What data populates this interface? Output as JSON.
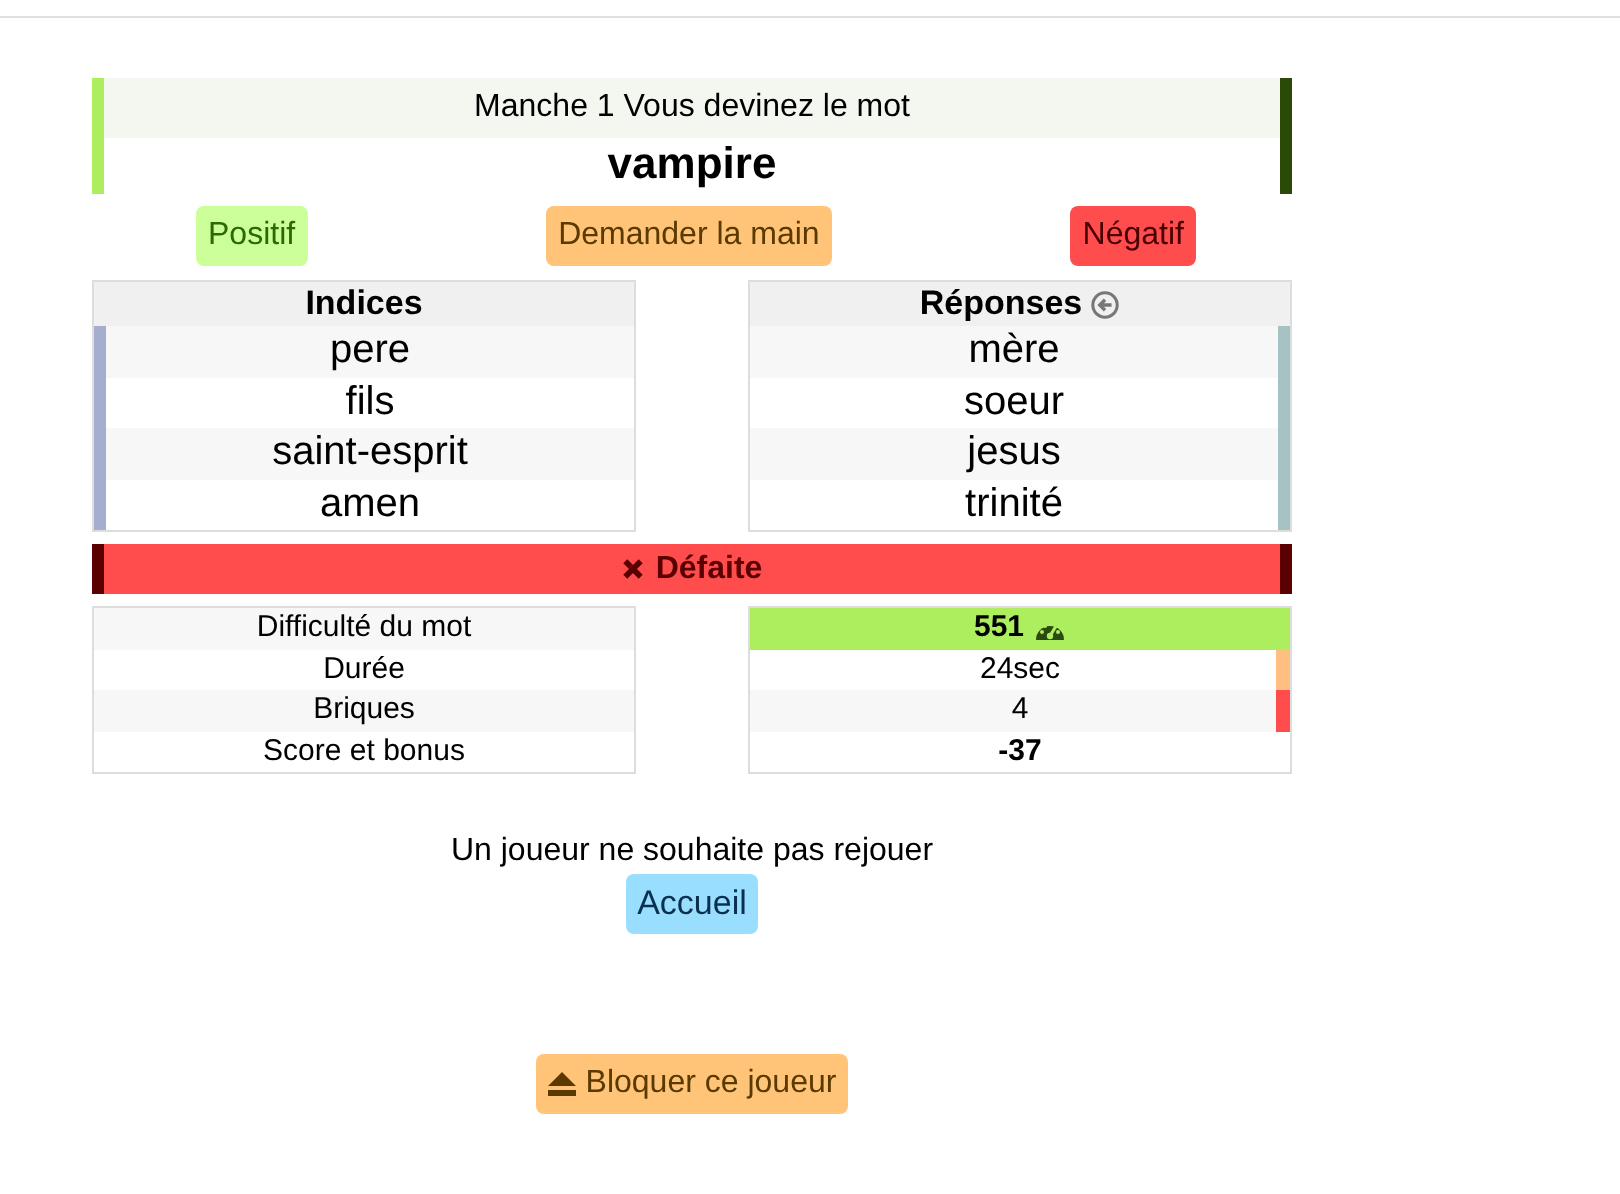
{
  "round": {
    "label": "Manche 1 Vous devinez le mot",
    "word": "vampire"
  },
  "actions": [
    {
      "label": "Positif",
      "kind": "positive"
    },
    {
      "label": "Demander la main",
      "kind": "hand"
    },
    {
      "label": "Négatif",
      "kind": "negative"
    }
  ],
  "clues": {
    "title": "Indices",
    "items": [
      "pere",
      "fils",
      "saint-esprit",
      "amen"
    ]
  },
  "answers": {
    "title": "Réponses",
    "items": [
      "mère",
      "soeur",
      "jesus",
      "trinité"
    ]
  },
  "result": {
    "label": "Défaite",
    "kind": "defeat"
  },
  "stats": [
    {
      "label": "Difficulté du mot",
      "value": "551",
      "kind": "highlight",
      "color": "#adee5e"
    },
    {
      "label": "Durée",
      "value": "24sec",
      "kind": "bar",
      "color": "#ffbf80"
    },
    {
      "label": "Briques",
      "value": "4",
      "kind": "bar",
      "color": "#ff4d4d"
    },
    {
      "label": "Score et bonus",
      "value": "-37",
      "kind": "bold"
    }
  ],
  "message": "Un joueur ne souhaite pas rejouer",
  "home_button": "Accueil",
  "block_button": "Bloquer ce joueur"
}
